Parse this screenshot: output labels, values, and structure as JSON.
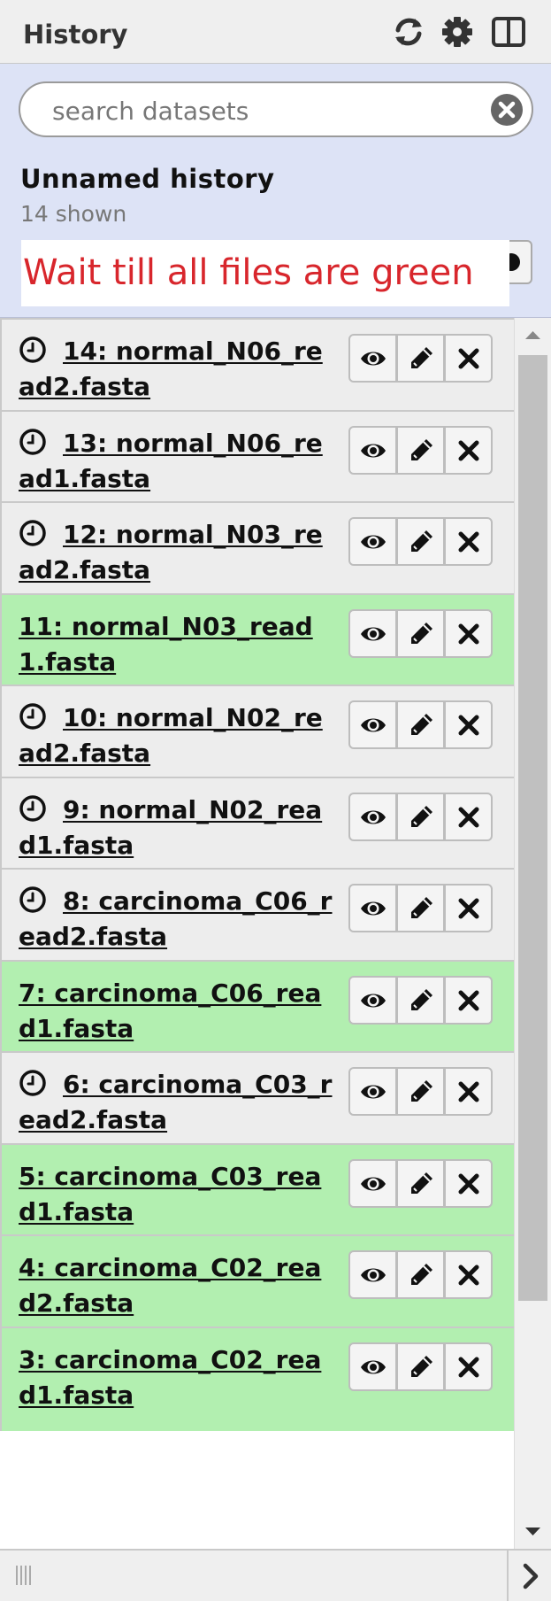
{
  "header": {
    "title": "History",
    "icons": [
      "refresh-icon",
      "gear-icon",
      "columns-icon"
    ]
  },
  "search": {
    "placeholder": "search datasets",
    "value": ""
  },
  "history": {
    "name": "Unnamed history",
    "shown": "14 shown"
  },
  "annotation": {
    "text": "Wait till all files are green",
    "color": "#d8262c"
  },
  "colors": {
    "queued_bg": "#ededed",
    "ok_bg": "#b2efb0",
    "panel_bg": "#dde3f6"
  },
  "datasets": [
    {
      "label": "14: normal_N06_read2.fasta",
      "state": "queued"
    },
    {
      "label": "13: normal_N06_read1.fasta",
      "state": "queued"
    },
    {
      "label": "12: normal_N03_read2.fasta",
      "state": "queued"
    },
    {
      "label": "11: normal_N03_read1.fasta",
      "state": "ok"
    },
    {
      "label": "10: normal_N02_read2.fasta",
      "state": "queued"
    },
    {
      "label": "9: normal_N02_read1.fasta",
      "state": "queued"
    },
    {
      "label": "8: carcinoma_C06_read2.fasta",
      "state": "queued"
    },
    {
      "label": "7: carcinoma_C06_read1.fasta",
      "state": "ok"
    },
    {
      "label": "6: carcinoma_C03_read2.fasta",
      "state": "queued"
    },
    {
      "label": "5: carcinoma_C03_read1.fasta",
      "state": "ok"
    },
    {
      "label": "4: carcinoma_C02_read2.fasta",
      "state": "ok"
    },
    {
      "label": "3: carcinoma_C02_read1.fasta",
      "state": "ok"
    }
  ],
  "item_actions": [
    "eye-icon",
    "pencil-icon",
    "delete-icon"
  ]
}
